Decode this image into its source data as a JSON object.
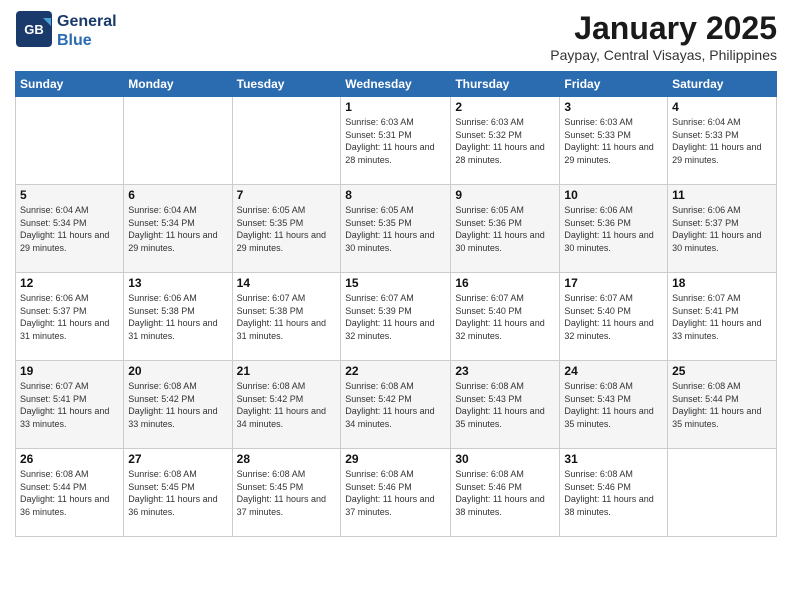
{
  "logo": {
    "line1": "General",
    "line2": "Blue"
  },
  "title": "January 2025",
  "subtitle": "Paypay, Central Visayas, Philippines",
  "days_of_week": [
    "Sunday",
    "Monday",
    "Tuesday",
    "Wednesday",
    "Thursday",
    "Friday",
    "Saturday"
  ],
  "weeks": [
    [
      {
        "day": "",
        "info": ""
      },
      {
        "day": "",
        "info": ""
      },
      {
        "day": "",
        "info": ""
      },
      {
        "day": "1",
        "info": "Sunrise: 6:03 AM\nSunset: 5:31 PM\nDaylight: 11 hours and 28 minutes."
      },
      {
        "day": "2",
        "info": "Sunrise: 6:03 AM\nSunset: 5:32 PM\nDaylight: 11 hours and 28 minutes."
      },
      {
        "day": "3",
        "info": "Sunrise: 6:03 AM\nSunset: 5:33 PM\nDaylight: 11 hours and 29 minutes."
      },
      {
        "day": "4",
        "info": "Sunrise: 6:04 AM\nSunset: 5:33 PM\nDaylight: 11 hours and 29 minutes."
      }
    ],
    [
      {
        "day": "5",
        "info": "Sunrise: 6:04 AM\nSunset: 5:34 PM\nDaylight: 11 hours and 29 minutes."
      },
      {
        "day": "6",
        "info": "Sunrise: 6:04 AM\nSunset: 5:34 PM\nDaylight: 11 hours and 29 minutes."
      },
      {
        "day": "7",
        "info": "Sunrise: 6:05 AM\nSunset: 5:35 PM\nDaylight: 11 hours and 29 minutes."
      },
      {
        "day": "8",
        "info": "Sunrise: 6:05 AM\nSunset: 5:35 PM\nDaylight: 11 hours and 30 minutes."
      },
      {
        "day": "9",
        "info": "Sunrise: 6:05 AM\nSunset: 5:36 PM\nDaylight: 11 hours and 30 minutes."
      },
      {
        "day": "10",
        "info": "Sunrise: 6:06 AM\nSunset: 5:36 PM\nDaylight: 11 hours and 30 minutes."
      },
      {
        "day": "11",
        "info": "Sunrise: 6:06 AM\nSunset: 5:37 PM\nDaylight: 11 hours and 30 minutes."
      }
    ],
    [
      {
        "day": "12",
        "info": "Sunrise: 6:06 AM\nSunset: 5:37 PM\nDaylight: 11 hours and 31 minutes."
      },
      {
        "day": "13",
        "info": "Sunrise: 6:06 AM\nSunset: 5:38 PM\nDaylight: 11 hours and 31 minutes."
      },
      {
        "day": "14",
        "info": "Sunrise: 6:07 AM\nSunset: 5:38 PM\nDaylight: 11 hours and 31 minutes."
      },
      {
        "day": "15",
        "info": "Sunrise: 6:07 AM\nSunset: 5:39 PM\nDaylight: 11 hours and 32 minutes."
      },
      {
        "day": "16",
        "info": "Sunrise: 6:07 AM\nSunset: 5:40 PM\nDaylight: 11 hours and 32 minutes."
      },
      {
        "day": "17",
        "info": "Sunrise: 6:07 AM\nSunset: 5:40 PM\nDaylight: 11 hours and 32 minutes."
      },
      {
        "day": "18",
        "info": "Sunrise: 6:07 AM\nSunset: 5:41 PM\nDaylight: 11 hours and 33 minutes."
      }
    ],
    [
      {
        "day": "19",
        "info": "Sunrise: 6:07 AM\nSunset: 5:41 PM\nDaylight: 11 hours and 33 minutes."
      },
      {
        "day": "20",
        "info": "Sunrise: 6:08 AM\nSunset: 5:42 PM\nDaylight: 11 hours and 33 minutes."
      },
      {
        "day": "21",
        "info": "Sunrise: 6:08 AM\nSunset: 5:42 PM\nDaylight: 11 hours and 34 minutes."
      },
      {
        "day": "22",
        "info": "Sunrise: 6:08 AM\nSunset: 5:42 PM\nDaylight: 11 hours and 34 minutes."
      },
      {
        "day": "23",
        "info": "Sunrise: 6:08 AM\nSunset: 5:43 PM\nDaylight: 11 hours and 35 minutes."
      },
      {
        "day": "24",
        "info": "Sunrise: 6:08 AM\nSunset: 5:43 PM\nDaylight: 11 hours and 35 minutes."
      },
      {
        "day": "25",
        "info": "Sunrise: 6:08 AM\nSunset: 5:44 PM\nDaylight: 11 hours and 35 minutes."
      }
    ],
    [
      {
        "day": "26",
        "info": "Sunrise: 6:08 AM\nSunset: 5:44 PM\nDaylight: 11 hours and 36 minutes."
      },
      {
        "day": "27",
        "info": "Sunrise: 6:08 AM\nSunset: 5:45 PM\nDaylight: 11 hours and 36 minutes."
      },
      {
        "day": "28",
        "info": "Sunrise: 6:08 AM\nSunset: 5:45 PM\nDaylight: 11 hours and 37 minutes."
      },
      {
        "day": "29",
        "info": "Sunrise: 6:08 AM\nSunset: 5:46 PM\nDaylight: 11 hours and 37 minutes."
      },
      {
        "day": "30",
        "info": "Sunrise: 6:08 AM\nSunset: 5:46 PM\nDaylight: 11 hours and 38 minutes."
      },
      {
        "day": "31",
        "info": "Sunrise: 6:08 AM\nSunset: 5:46 PM\nDaylight: 11 hours and 38 minutes."
      },
      {
        "day": "",
        "info": ""
      }
    ]
  ]
}
